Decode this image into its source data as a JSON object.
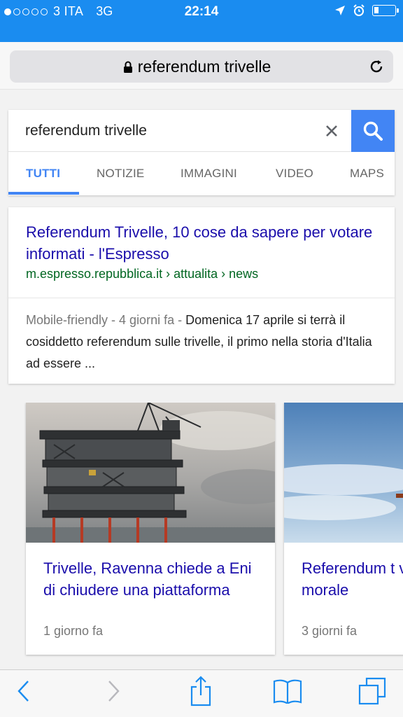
{
  "status_bar": {
    "carrier": "3 ITA",
    "network": "3G",
    "time": "22:14",
    "icons": [
      "signal-dots-icon",
      "location-arrow-icon",
      "alarm-clock-icon",
      "battery-icon"
    ]
  },
  "address_bar": {
    "url_text": "referendum trivelle",
    "icons": [
      "lock-icon",
      "reload-icon"
    ]
  },
  "search": {
    "query": "referendum trivelle",
    "tabs": [
      {
        "label": "TUTTI",
        "active": true
      },
      {
        "label": "NOTIZIE",
        "active": false
      },
      {
        "label": "IMMAGINI",
        "active": false
      },
      {
        "label": "VIDEO",
        "active": false
      },
      {
        "label": "MAPS",
        "active": false
      }
    ]
  },
  "result": {
    "title": "Referendum Trivelle, 10 cose da sapere per votare informati - l'Espresso",
    "url": "m.espresso.repubblica.it › attualita › news",
    "meta": "Mobile-friendly - 4 giorni fa - ",
    "snippet": "Domenica 17 aprile si terrà il cosiddetto referendum sulle trivelle, il primo nella storia d'Italia ad essere ..."
  },
  "news": [
    {
      "title": "Trivelle, Ravenna chiede a Eni di chiudere una piattaforma",
      "time": "1 giorno fa"
    },
    {
      "title": "Referendum t votare sì è un morale",
      "time": "3 giorni fa"
    }
  ],
  "colors": {
    "status_bar": "#1a8cf0",
    "link": "#1a0dab",
    "url_green": "#006621",
    "google_blue": "#4285f4"
  }
}
